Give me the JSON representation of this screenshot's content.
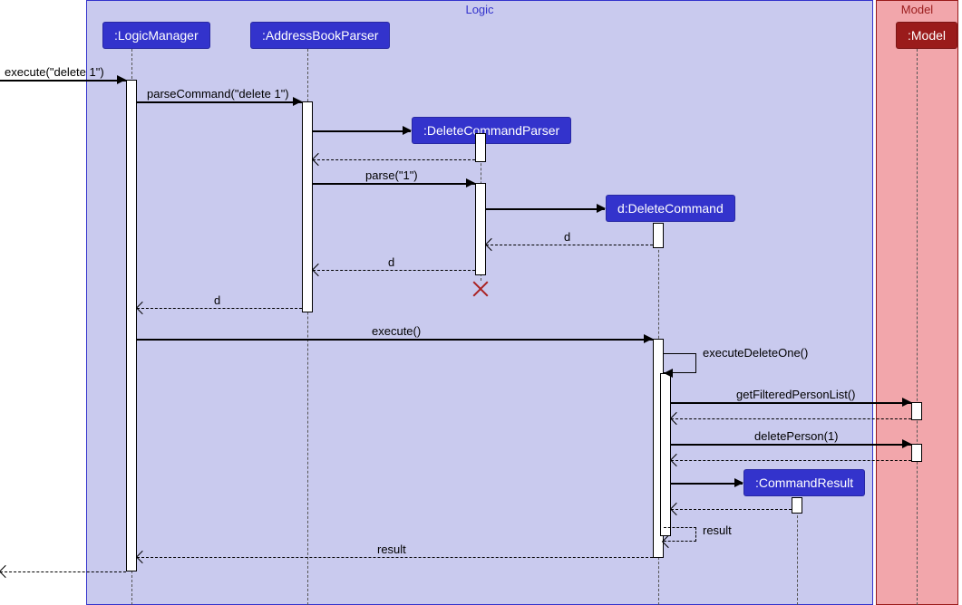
{
  "regions": {
    "logic": {
      "title": "Logic",
      "bg": "#c9caee",
      "border": "#3333cc"
    },
    "model": {
      "title": "Model",
      "bg": "#f2a6ab",
      "border": "#9a1b1b"
    }
  },
  "participants": {
    "logicManager": ":LogicManager",
    "addressBookParser": ":AddressBookParser",
    "deleteCommandParser": ":DeleteCommandParser",
    "deleteCommand": "d:DeleteCommand",
    "commandResult": ":CommandResult",
    "model": ":Model"
  },
  "messages": {
    "execute_in": "execute(\"delete 1\")",
    "parseCommand": "parseCommand(\"delete 1\")",
    "parse": "parse(\"1\")",
    "ret_d1": "d",
    "ret_d2": "d",
    "ret_d3": "d",
    "execute_call": "execute()",
    "executeDeleteOne": "executeDeleteOne()",
    "getFiltered": "getFilteredPersonList()",
    "deletePerson": "deletePerson(1)",
    "ret_result_inner": "result",
    "ret_result": "result"
  },
  "colors": {
    "logic_box": "#3333cc",
    "model_box": "#9a1b1b"
  }
}
